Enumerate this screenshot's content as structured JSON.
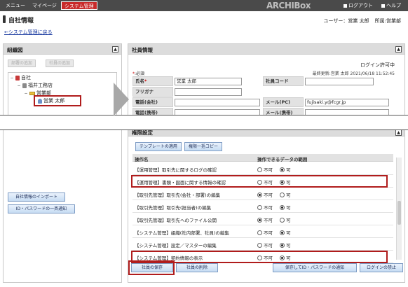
{
  "topbar": {
    "nav": [
      "メニュー",
      "マイページ",
      "システム管理"
    ],
    "active_index": 2,
    "brand": "ARCHIBox",
    "links": [
      "ログアウト",
      "ヘルプ"
    ]
  },
  "page": {
    "title": "自社情報",
    "user_label": "ユーザー：営業 太郎",
    "dept_label": "所属:営業部",
    "back_link": "←システム管理に戻る"
  },
  "org_panel": {
    "title": "組織図",
    "top_buttons": [
      "部署の追加",
      "社員の追加"
    ],
    "tree": [
      {
        "label": "自社",
        "level": 0
      },
      {
        "label": "福井工務店",
        "level": 1
      },
      {
        "label": "営業部",
        "level": 2
      },
      {
        "label": "営業 太郎",
        "level": 3
      }
    ],
    "bottom_buttons": [
      "自社情報のインポート",
      "ID・パスワードの一斉通知"
    ]
  },
  "employee": {
    "title": "社員情報",
    "login_status": "ログイン許可中",
    "required_note": "必須",
    "last_updated": "最終更新:営業 太郎  2021/06/18 11:52:45",
    "fields": {
      "name_label": "氏名",
      "name_value": "営業 太郎",
      "code_label": "社員コード",
      "code_value": "",
      "kana_label": "フリガナ",
      "kana_value": "",
      "phone_label": "電話(会社)",
      "phone_value": "",
      "email_pc_label": "メール(PC)",
      "email_pc_value": "fujisaki.y@fcgr.jp",
      "mobile_label": "電話(携帯)",
      "mobile_value": "",
      "email_mobile_label": "メール(携帯)",
      "email_mobile_value": ""
    }
  },
  "permissions": {
    "title": "権限設定",
    "template_button": "テンプレートの適用",
    "copy_button": "権限一括コピー",
    "col_name": "操作名",
    "col_scope": "操作できるデータの範囲",
    "no_label": "不可",
    "yes_label": "可",
    "rows": [
      {
        "name": "【運用管理】取引先に関するログの確認",
        "value": "yes",
        "highlight": false
      },
      {
        "name": "【運用管理】書類・図面に関する情報の確認",
        "value": "yes",
        "highlight": true
      },
      {
        "name": "【取引先管理】取引先(会社・部署)の編集",
        "value": "no",
        "highlight": false
      },
      {
        "name": "【取引先管理】取引先(担当者)の編集",
        "value": "yes",
        "highlight": false
      },
      {
        "name": "【取引先管理】取引先へのファイル公開",
        "value": "no",
        "highlight": false
      },
      {
        "name": "【システム管理】組織(社内部署、社員)の編集",
        "value": "yes",
        "highlight": false
      },
      {
        "name": "【システム管理】設定／マスターの編集",
        "value": "yes",
        "highlight": false
      },
      {
        "name": "【システム管理】契約情報の表示",
        "value": "yes",
        "highlight": true
      }
    ]
  },
  "footer_buttons": {
    "save": "社員の保存",
    "delete": "社員の削除",
    "save_notify": "保存してID・パスワードの通知",
    "block_login": "ログインの禁止"
  }
}
